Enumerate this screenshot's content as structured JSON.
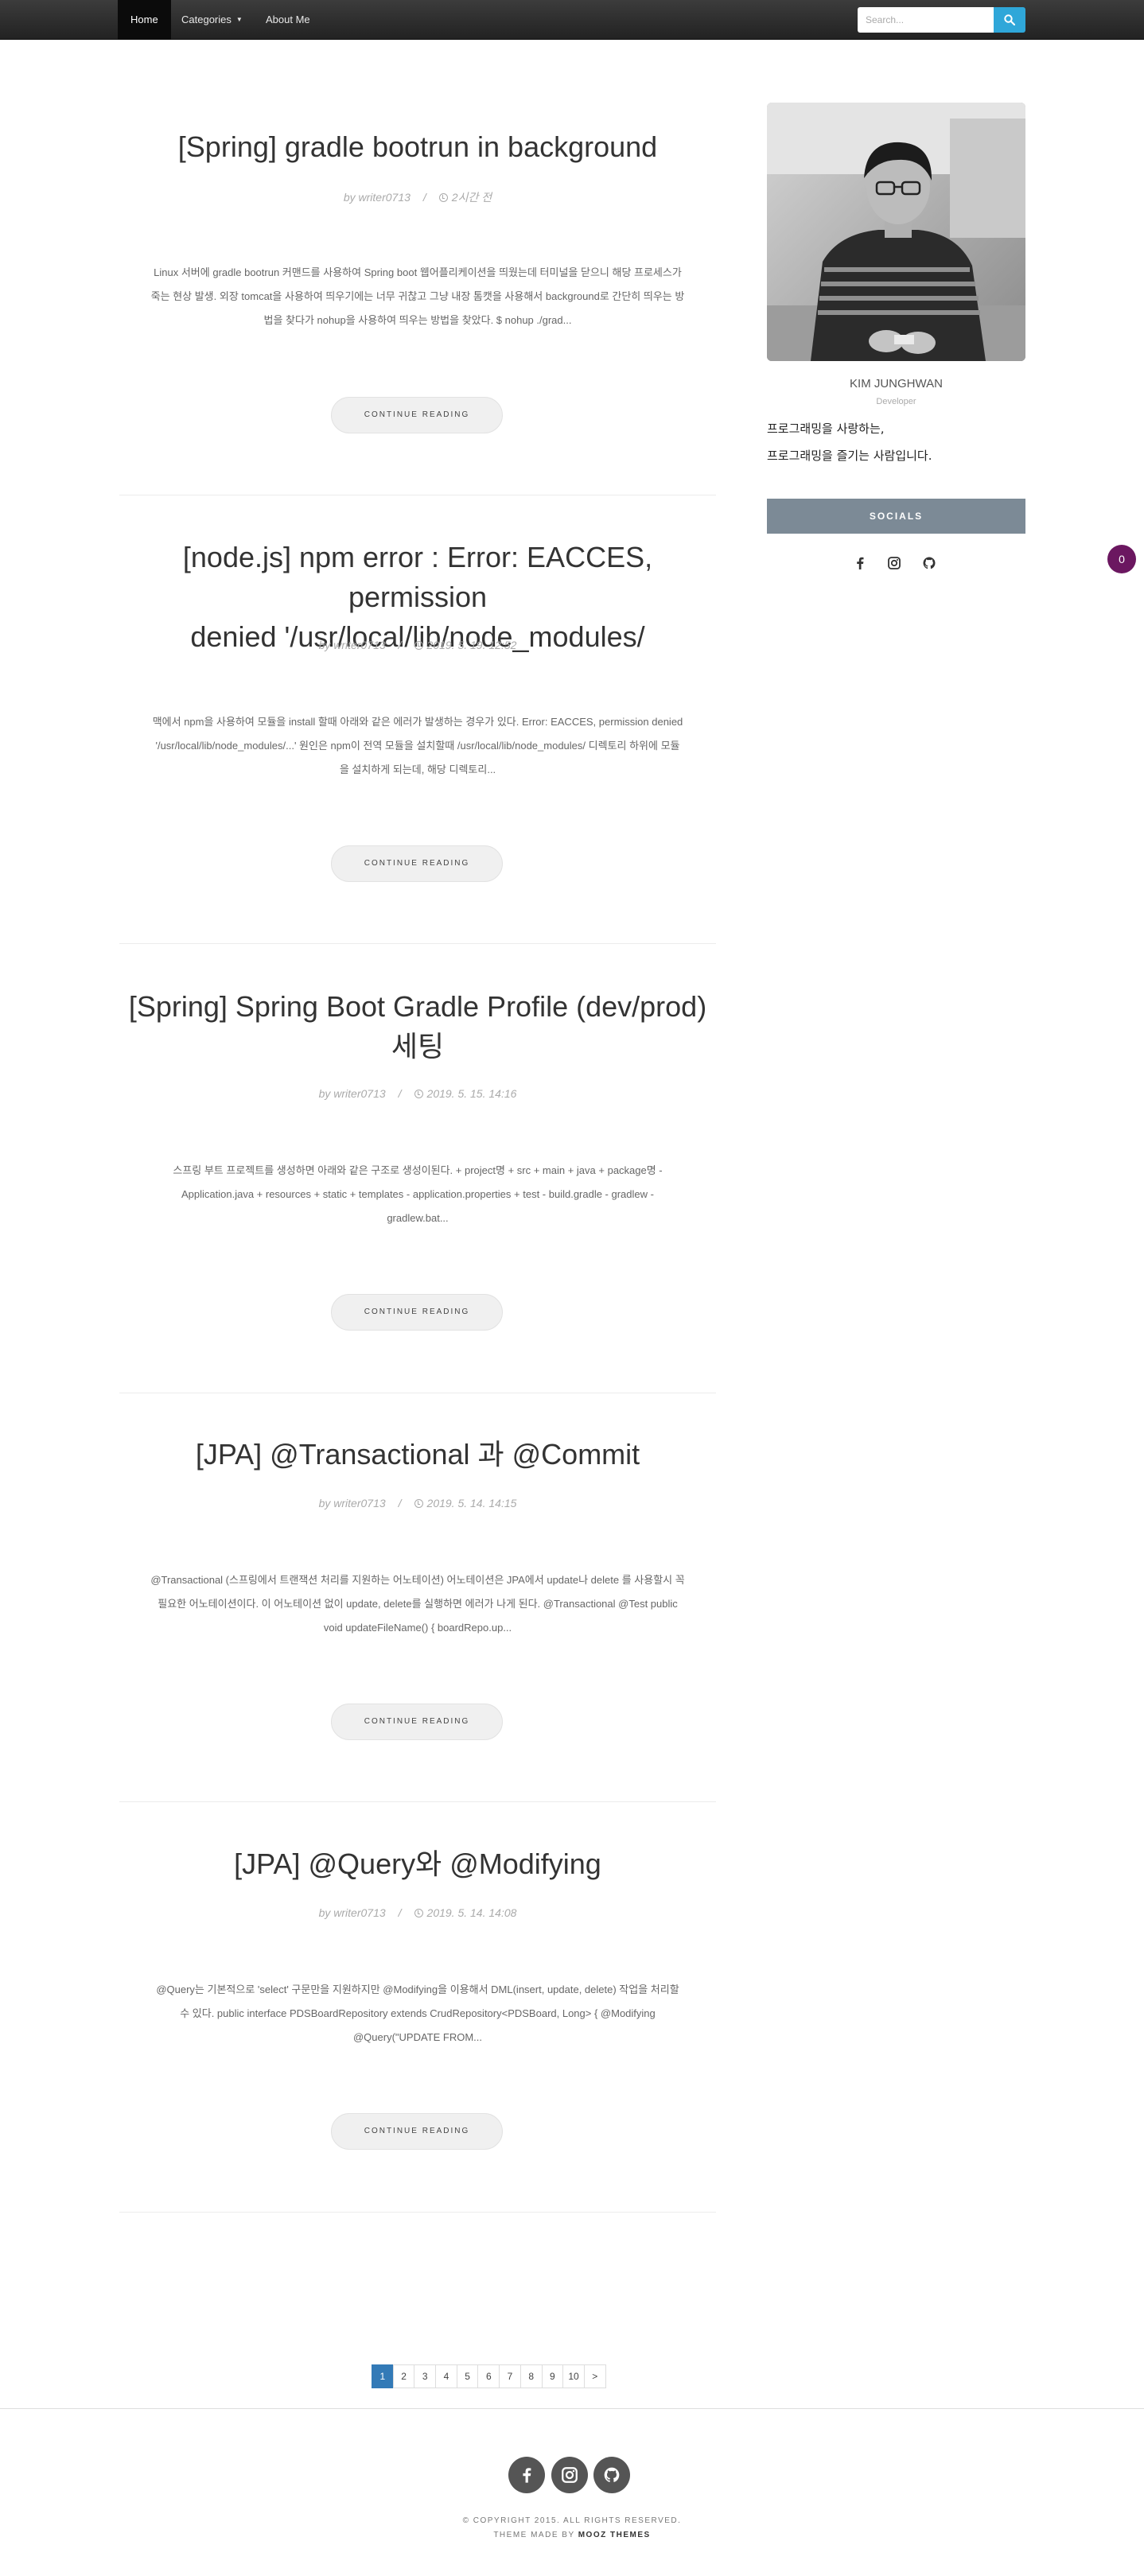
{
  "nav": {
    "home": "Home",
    "categories": "Categories",
    "about": "About Me",
    "search_placeholder": "Search..."
  },
  "posts": [
    {
      "title": "[Spring] gradle bootrun in background",
      "author": "by writer0713",
      "date": "2시간 전",
      "excerpt_lines": [
        "Linux 서버에 gradle bootrun 커맨드를 사용하여 Spring boot 웹어플리케이션을 띄웠는데 터미널을 닫으니 해당 프로세스가",
        "죽는 현상 발생. 외장 tomcat을 사용하여 띄우기에는 너무 귀찮고 그냥 내장 톰캣을 사용해서 background로 간단히 띄우는 방",
        "법을 찾다가 nohup을 사용하여 띄우는 방법을 찾았다. $ nohup ./grad..."
      ],
      "button": "CONTINUE READING"
    },
    {
      "title_lines": [
        "[node.js] npm error : Error: EACCES, permission",
        "denied '/usr/local/lib/node_modules/"
      ],
      "author": "by writer0713",
      "date": "2019. 5. 19. 12:52",
      "excerpt_lines": [
        "맥에서 npm을 사용하여 모듈을 install 할때 아래와 같은 에러가 발생하는 경우가 있다. Error: EACCES, permission denied",
        "'/usr/local/lib/node_modules/...' 원인은 npm이 전역 모듈을 설치할때 /usr/local/lib/node_modules/ 디렉토리 하위에 모듈",
        "을 설치하게 되는데, 해당 디렉토리..."
      ],
      "button": "CONTINUE READING"
    },
    {
      "title_lines": [
        "[Spring] Spring Boot Gradle Profile (dev/prod)",
        "세팅"
      ],
      "author": "by writer0713",
      "date": "2019. 5. 15. 14:16",
      "excerpt_lines": [
        "스프링 부트 프로젝트를 생성하면 아래와 같은 구조로 생성이된다. + project명 + src + main + java + package명 -",
        "Application.java + resources + static + templates - application.properties + test - build.gradle - gradlew -",
        "gradlew.bat..."
      ],
      "button": "CONTINUE READING"
    },
    {
      "title": "[JPA] @Transactional 과 @Commit",
      "author": "by writer0713",
      "date": "2019. 5. 14. 14:15",
      "excerpt_lines": [
        "@Transactional (스프링에서 트랜잭션 처리를 지원하는 어노테이션) 어노테이션은 JPA에서 update나 delete 를 사용할시 꼭",
        "필요한 어노테이션이다. 이 어노테이션 없이 update, delete를 실행하면 에러가 나게 된다. @Transactional @Test public",
        "void updateFileName() { boardRepo.up..."
      ],
      "button": "CONTINUE READING"
    },
    {
      "title": "[JPA] @Query와 @Modifying",
      "author": "by writer0713",
      "date": "2019. 5. 14. 14:08",
      "excerpt_lines": [
        "@Query는 기본적으로 'select' 구문만을 지원하지만 @Modifying을 이용해서 DML(insert, update, delete) 작업을 처리할",
        "수 있다. public interface PDSBoardRepository extends CrudRepository<PDSBoard, Long> { @Modifying",
        "@Query(\"UPDATE FROM..."
      ],
      "button": "CONTINUE READING"
    }
  ],
  "sidebar": {
    "name": "KIM JUNGHWAN",
    "role": "Developer",
    "desc_line1": "프로그래밍을 사랑하는,",
    "desc_line2": "프로그래밍을 즐기는 사람입니다.",
    "socials_title": "SOCIALS",
    "social_icons": [
      "facebook-icon",
      "instagram-icon",
      "github-icon"
    ]
  },
  "badge": {
    "count": "0",
    "color": "#6b1760"
  },
  "pagination": {
    "pages": [
      "1",
      "2",
      "3",
      "4",
      "5",
      "6",
      "7",
      "8",
      "9",
      "10",
      ">"
    ],
    "active": "1",
    "active_color": "#337ab7"
  },
  "footer": {
    "copyright": "© COPYRIGHT 2015. ALL RIGHTS RESERVED.",
    "made_prefix": "THEME MADE BY",
    "made_by": "MOOZ THEMES"
  },
  "colors": {
    "accent": "#2fa7d9",
    "socials_bar": "#7c8a96"
  }
}
